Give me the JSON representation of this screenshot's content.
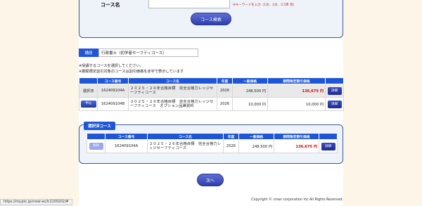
{
  "search": {
    "course_name_label": "コース名",
    "course_name_value": "",
    "input_note": "※キーワードを入力（1文、2文、3.5単 等）",
    "search_button": "コース検索"
  },
  "category": {
    "label": "講座",
    "value": "行政書士（初学者セーフティコース）"
  },
  "notes": [
    "※受講するコースを選択してください。",
    "※期間限定割引対象のコースは割引価格を赤字で表示しています"
  ],
  "course_table": {
    "headers": [
      "",
      "コース番号",
      "コース名",
      "年度",
      "一般価格",
      "期間限定割引価格",
      ""
    ],
    "rows": [
      {
        "status": "選択済",
        "number": "162409104A",
        "name": "２０２５・２６年合格目標　完全合格力レッジセーフティコース",
        "year": "2026",
        "price": "248,500 円",
        "discount": "136,675 円",
        "discount_red": true,
        "detail": "詳細"
      },
      {
        "status": "申込",
        "number": "162409104B",
        "name": "２０２５・２６年合格目標　完全合格力レッジセーフティコース　オプション品練資料",
        "year": "2026",
        "price": "10,000 円",
        "discount": "10,000 円",
        "discount_red": false,
        "detail": "詳細"
      }
    ]
  },
  "selected": {
    "heading": "選択済コース",
    "headers": [
      "",
      "コース番号",
      "コース名",
      "年度",
      "一般価格",
      "期間限定割引価格",
      ""
    ],
    "rows": [
      {
        "remove": "削除",
        "number": "162409104A",
        "name": "２０２５・２６年合格目標　完全合格力レッジセーフティコース",
        "year": "2026",
        "price": "248,500 円",
        "discount": "136,675 円",
        "detail": "詳細"
      }
    ]
  },
  "next_button": "次へ",
  "copyright": "Copyright © crear corporation inc All Rights Reserved.",
  "status_url": "https://my.ptc.jp/crear-ac/lc1100202/#",
  "colors": {
    "accent_blue": "#1f56d8",
    "discount_red": "#d00000",
    "page_background": "#fdf6e8"
  }
}
